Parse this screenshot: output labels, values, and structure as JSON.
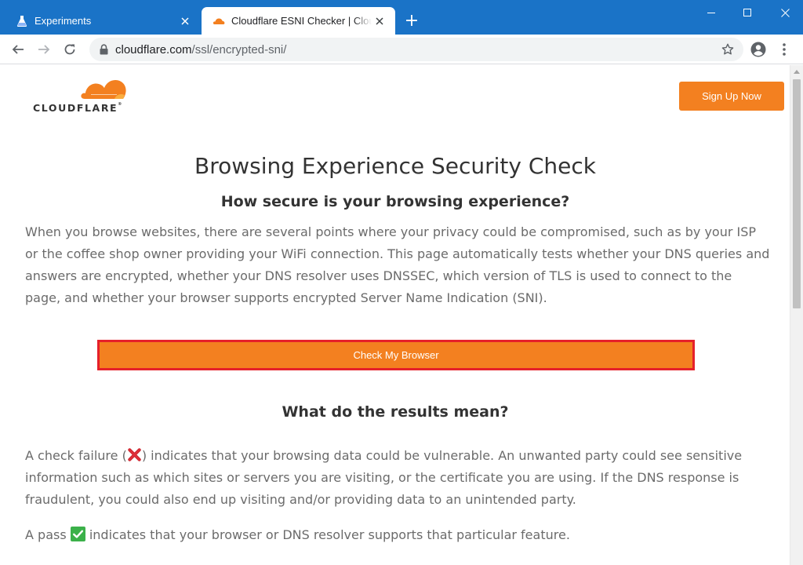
{
  "browser": {
    "tabs": [
      {
        "title": "Experiments",
        "favicon": "flask-icon",
        "active": false
      },
      {
        "title": "Cloudflare ESNI Checker | Cloudflare",
        "favicon": "cloudflare-cloud-icon",
        "active": true
      }
    ],
    "new_tab_symbol": "+",
    "address_bar": {
      "host": "cloudflare.com",
      "path": "/ssl/encrypted-sni/"
    },
    "colors": {
      "titlebar": "#1a73c7",
      "omnibox": "#f1f3f4"
    }
  },
  "page": {
    "logo_text": "CLOUDFLARE",
    "logo_mark": "®",
    "signup_label": "Sign Up Now",
    "title": "Browsing Experience Security Check",
    "subtitle": "How secure is your browsing experience?",
    "intro": "When you browse websites, there are several points where your privacy could be compromised, such as by your ISP or the coffee shop owner providing your WiFi connection. This page automatically tests whether your DNS queries and answers are encrypted, whether your DNS resolver uses DNSSEC, which version of TLS is used to connect to the page, and whether your browser supports encrypted Server Name Indication (SNI).",
    "check_button_label": "Check My Browser",
    "results_heading": "What do the results mean?",
    "fail_prefix": "A check failure (",
    "fail_suffix": ") indicates that your browsing data could be vulnerable. An unwanted party could see sensitive information such as which sites or servers you are visiting, or the certificate you are using. If the DNS response is fraudulent, you could also end up visiting and/or providing data to an unintended party.",
    "pass_prefix": "A pass ",
    "pass_suffix": " indicates that your browser or DNS resolver supports that particular feature.",
    "colors": {
      "accent": "#f38020",
      "highlight_border": "#e5202a",
      "body_text": "#6b6b6b",
      "heading": "#333333"
    }
  }
}
